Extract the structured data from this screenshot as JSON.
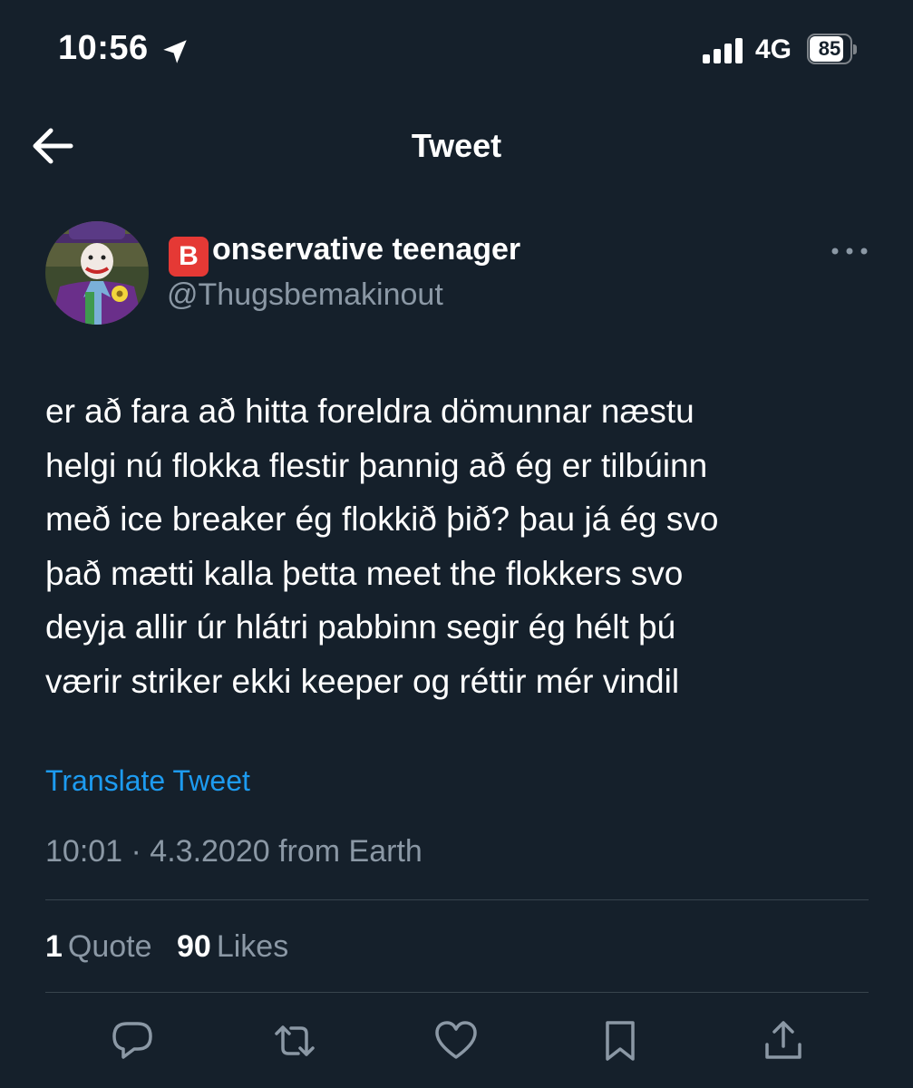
{
  "status_bar": {
    "time": "10:56",
    "network": "4G",
    "battery_level": "85",
    "battery_fraction": 0.85
  },
  "header": {
    "title": "Tweet",
    "back_icon": "arrow-left-icon"
  },
  "author": {
    "badge_letter": "B",
    "display_name": "onservative teenager",
    "handle": "@Thugsbemakinout",
    "more_icon": "more-horizontal-icon"
  },
  "tweet": {
    "lines": [
      "er að fara að hitta foreldra dömunnar næstu",
      "helgi nú flokka flestir þannig að ég er tilbúinn",
      "með ice breaker ég flokkið þið? þau já ég svo",
      "það mætti kalla þetta meet the flokkers svo",
      "deyja allir úr hlátri pabbinn segir ég hélt þú",
      "værir striker ekki keeper og réttir mér vindil"
    ],
    "translate_label": "Translate Tweet",
    "meta": "10:01 · 4.3.2020 from Earth"
  },
  "stats": {
    "quotes_count": "1",
    "quotes_label": "Quote",
    "likes_count": "90",
    "likes_label": "Likes"
  },
  "actions": [
    "reply-icon",
    "retweet-icon",
    "like-icon",
    "bookmark-icon",
    "share-icon"
  ],
  "colors": {
    "background": "#15202b",
    "text": "#ffffff",
    "secondary_text": "#8b98a5",
    "link": "#1d9bf0",
    "divider": "#38444d",
    "badge": "#e53935"
  }
}
